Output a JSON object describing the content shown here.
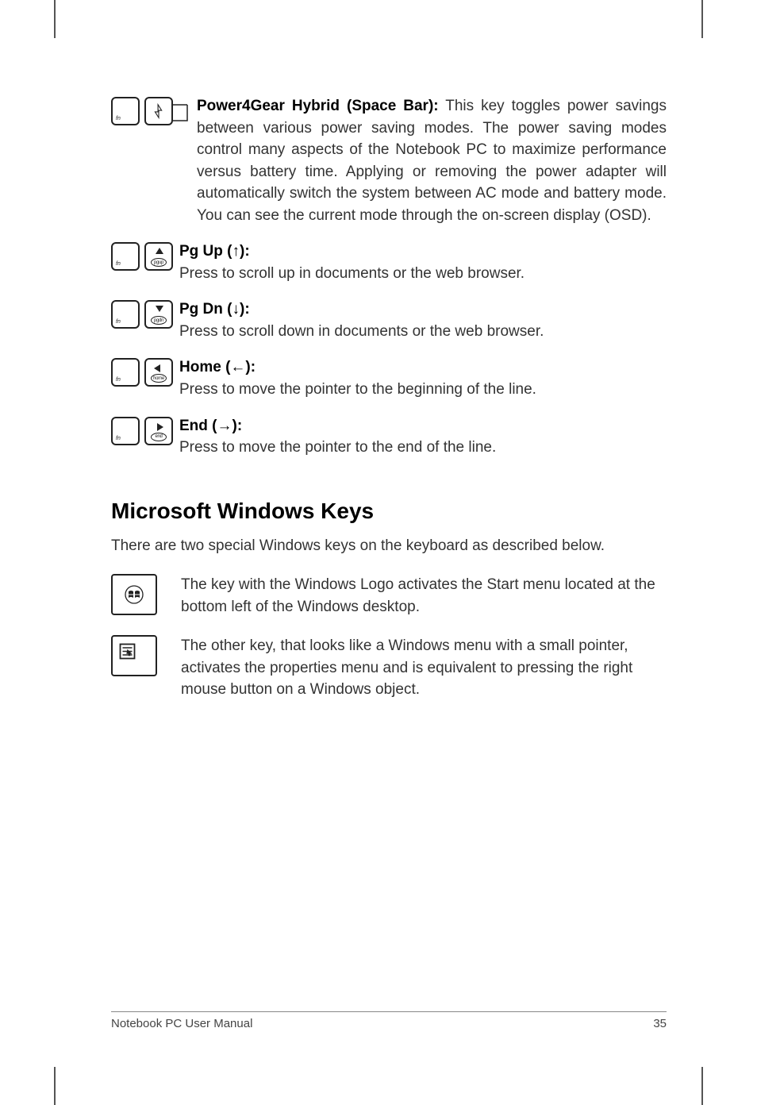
{
  "items": {
    "power4gear": {
      "title": "Power4Gear Hybrid (Space Bar):",
      "body": " This key toggles power savings between various power saving modes. The power saving modes control many aspects of the Notebook PC to maximize performance versus battery time. Applying or removing the power adapter will automatically switch the system between AC mode and battery mode. You can see the current mode through the on-screen display (OSD)."
    },
    "pgup": {
      "title": "Pg Up (↑):",
      "body": "Press to scroll up in documents or the web browser."
    },
    "pgdn": {
      "title": "Pg Dn (↓):",
      "body": "Press to scroll down in documents or the web browser."
    },
    "home": {
      "title": "Home (←):",
      "body": "Press to move the pointer to the beginning of the line."
    },
    "end": {
      "title": "End (→):",
      "body": "Press to move the pointer to the end of the line."
    }
  },
  "keylabels": {
    "fn": "fn",
    "pgup": "pgup",
    "pgdn": "pgdn",
    "home": "home",
    "end": "end"
  },
  "windows_section": {
    "heading": "Microsoft Windows Keys",
    "intro": "There are two special Windows keys on the keyboard as described below.",
    "winlogo": "The key with the Windows Logo activates the Start menu located at the bottom left of the Windows desktop.",
    "menukey": "The other key, that looks like a Windows menu with a small pointer, activates the properties menu and is equivalent to pressing the right mouse button on a Windows object."
  },
  "footer": {
    "left": "Notebook PC User Manual",
    "right": "35"
  }
}
